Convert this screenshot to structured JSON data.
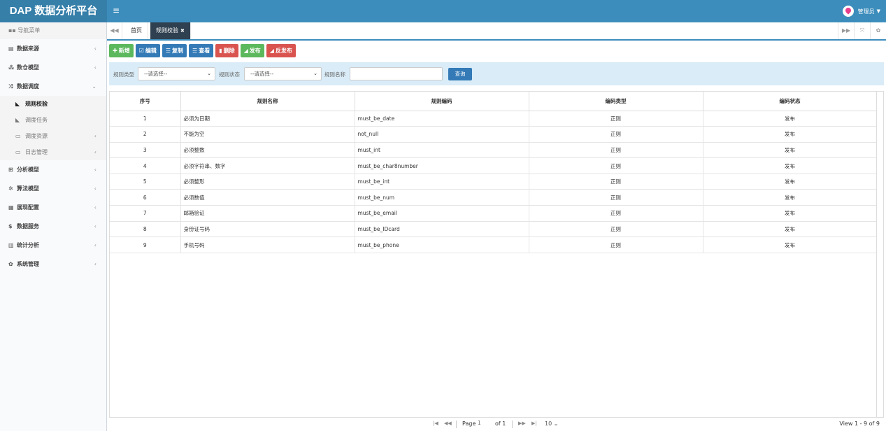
{
  "app": {
    "title": "DAP 数据分析平台",
    "menu_icon": "≡"
  },
  "user": {
    "name": "管理员"
  },
  "sidebar": {
    "header": "导航菜单",
    "items": [
      {
        "label": "数据来源",
        "icon": "database-icon"
      },
      {
        "label": "数仓模型",
        "icon": "cubes-icon"
      },
      {
        "label": "数据调度",
        "icon": "random-icon",
        "expanded": true
      },
      {
        "label": "分析模型",
        "icon": "sitemap-icon"
      },
      {
        "label": "算法模型",
        "icon": "spinner-icon"
      },
      {
        "label": "展现配置",
        "icon": "film-icon"
      },
      {
        "label": "数据服务",
        "icon": "dollar-icon"
      },
      {
        "label": "统计分析",
        "icon": "chart-icon"
      },
      {
        "label": "系统管理",
        "icon": "gear-icon"
      }
    ],
    "sub_items": [
      {
        "label": "规则校验",
        "active": true
      },
      {
        "label": "调度任务"
      },
      {
        "label": "调度资源"
      },
      {
        "label": "日志管理"
      }
    ]
  },
  "tabs": {
    "home": "首页",
    "active": "规则校验"
  },
  "toolbar": {
    "add": "新增",
    "edit": "编辑",
    "copy": "复制",
    "view": "查看",
    "delete": "删除",
    "publish": "发布",
    "unpublish": "反发布"
  },
  "search": {
    "type_label": "规则类型",
    "type_value": "--请选择--",
    "status_label": "规则状态",
    "status_value": "--请选择--",
    "name_label": "规则名称",
    "button": "查询"
  },
  "table": {
    "headers": [
      "序号",
      "规则名称",
      "规则编码",
      "编码类型",
      "编码状态"
    ],
    "rows": [
      [
        "1",
        "必须为日期",
        "must_be_date",
        "正则",
        "发布"
      ],
      [
        "2",
        "不能为空",
        "not_null",
        "正则",
        "发布"
      ],
      [
        "3",
        "必须整数",
        "must_int",
        "正则",
        "发布"
      ],
      [
        "4",
        "必须字符串、数字",
        "must_be_char8number",
        "正则",
        "发布"
      ],
      [
        "5",
        "必须整形",
        "must_be_int",
        "正则",
        "发布"
      ],
      [
        "6",
        "必须数值",
        "must_be_num",
        "正则",
        "发布"
      ],
      [
        "7",
        "邮箱验证",
        "must_be_email",
        "正则",
        "发布"
      ],
      [
        "8",
        "身份证号码",
        "must_be_IDcard",
        "正则",
        "发布"
      ],
      [
        "9",
        "手机号码",
        "must_be_phone",
        "正则",
        "发布"
      ]
    ]
  },
  "pager": {
    "page_label": "Page",
    "page_value": "1",
    "of_label": "of 1",
    "page_size": "10",
    "view_text": "View 1 - 9 of 9"
  }
}
